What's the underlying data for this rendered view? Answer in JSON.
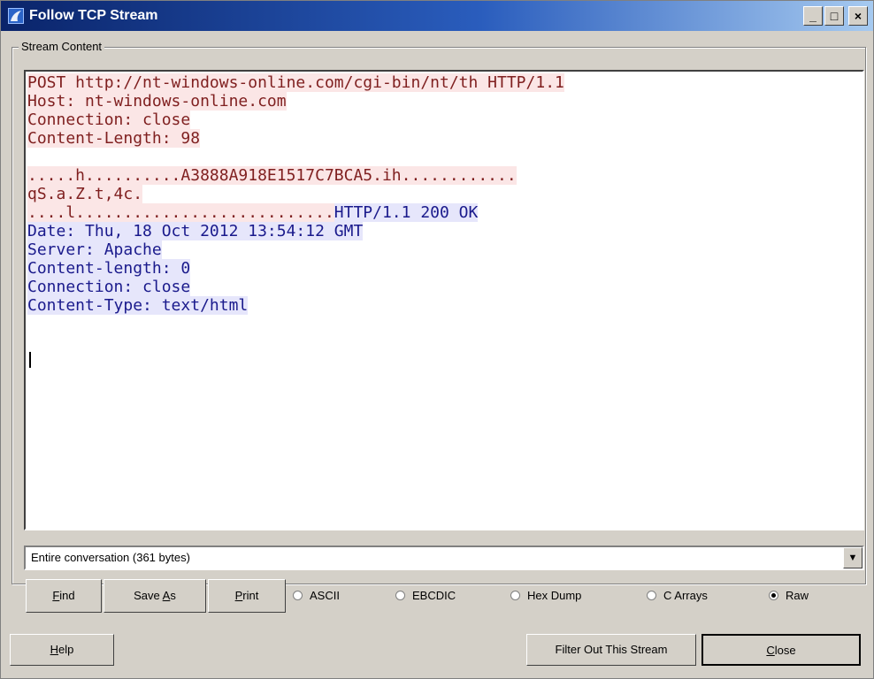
{
  "window": {
    "title": "Follow TCP Stream",
    "min_label": "_",
    "max_label": "□",
    "close_label": "×"
  },
  "stream": {
    "group_label": "Stream Content",
    "lines": [
      {
        "text": "POST http://nt-windows-online.com/cgi-bin/nt/th HTTP/1.1",
        "side": "client"
      },
      {
        "text": "Host: nt-windows-online.com",
        "side": "client"
      },
      {
        "text": "Connection: close",
        "side": "client"
      },
      {
        "text": "Content-Length: 98",
        "side": "client"
      },
      {
        "text": "",
        "side": "client"
      },
      {
        "text": ".....h..........A3888A918E1517C7BCA5.ih............",
        "side": "client"
      },
      {
        "text": "qS.a.Z.t,4c.",
        "side": "client"
      },
      {
        "text": "....l...........................",
        "side": "client",
        "tail": "HTTP/1.1 200 OK",
        "tail_side": "server"
      },
      {
        "text": "Date: Thu, 18 Oct 2012 13:54:12 GMT",
        "side": "server"
      },
      {
        "text": "Server: Apache",
        "side": "server"
      },
      {
        "text": "Content-length: 0",
        "side": "server"
      },
      {
        "text": "Connection: close",
        "side": "server"
      },
      {
        "text": "Content-Type: text/html",
        "side": "server"
      }
    ]
  },
  "conversation_select": {
    "value": "Entire conversation (361 bytes)",
    "arrow": "▼"
  },
  "buttons": {
    "find": {
      "pre": "",
      "accel": "F",
      "post": "ind"
    },
    "save_as": {
      "pre": "Save ",
      "accel": "A",
      "post": "s"
    },
    "print": {
      "pre": "",
      "accel": "P",
      "post": "rint"
    },
    "help": {
      "pre": "",
      "accel": "H",
      "post": "elp"
    },
    "filter": "Filter Out This Stream",
    "close": {
      "pre": "",
      "accel": "C",
      "post": "lose"
    }
  },
  "format_options": [
    {
      "label": "ASCII",
      "selected": false
    },
    {
      "label": "EBCDIC",
      "selected": false
    },
    {
      "label": "Hex Dump",
      "selected": false
    },
    {
      "label": "C Arrays",
      "selected": false
    },
    {
      "label": "Raw",
      "selected": true
    }
  ],
  "colors": {
    "client_fg": "#7f1f1f",
    "client_bg": "#fbe6e6",
    "server_fg": "#1a1a8c",
    "server_bg": "#e6e6fb"
  }
}
